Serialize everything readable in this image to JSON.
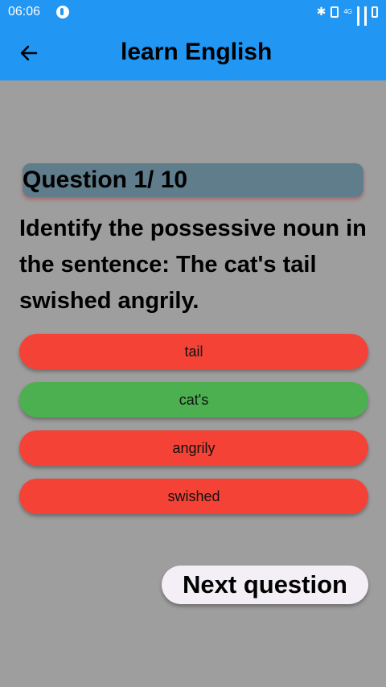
{
  "status_bar": {
    "time": "06:06",
    "network": "4G"
  },
  "app_bar": {
    "title": "learn English"
  },
  "quiz": {
    "progress_label": "Question 1/ 10",
    "question": "Identify the possessive noun in the sentence: The cat's tail swished angrily.",
    "answers": [
      {
        "label": "tail",
        "state": "wrong"
      },
      {
        "label": "cat's",
        "state": "correct"
      },
      {
        "label": "angrily",
        "state": "wrong"
      },
      {
        "label": "swished",
        "state": "wrong"
      }
    ],
    "next_label": "Next question"
  },
  "colors": {
    "app_bar": "#2196f3",
    "background": "#9e9e9e",
    "header": "#607d8b",
    "wrong": "#f44336",
    "correct": "#4caf50"
  }
}
